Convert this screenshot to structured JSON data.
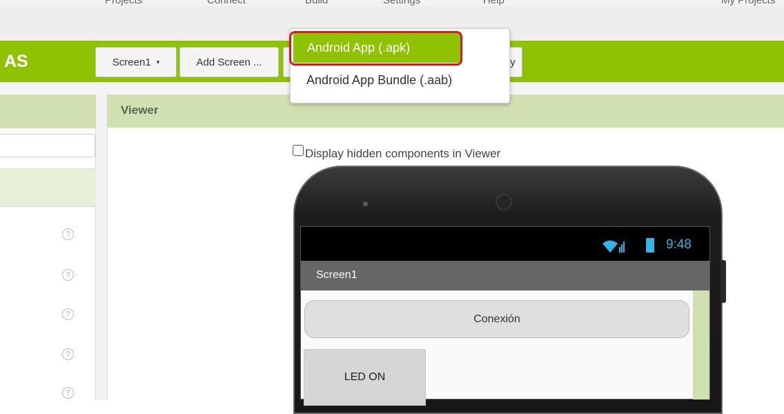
{
  "top_menu": {
    "items": [
      "Projects",
      "Connect",
      "Build",
      "Settings",
      "Help",
      "My Projects"
    ]
  },
  "app": {
    "name_fragment": "AS"
  },
  "toolbar": {
    "screen_dropdown_label": "Screen1",
    "screen_dropdown_caret": "▾",
    "add_screen_label": "Add Screen ...",
    "partial_button_tail": "y"
  },
  "build_menu": {
    "items": [
      {
        "label": "Android App (.apk)",
        "highlighted": true
      },
      {
        "label": "Android App Bundle (.aab)",
        "highlighted": false
      }
    ]
  },
  "left_panel": {
    "help_icon_glyph": "?",
    "help_icon_count": 5
  },
  "viewer": {
    "title": "Viewer",
    "hidden_components_label": "Display hidden components in Viewer",
    "hidden_components_checked": false
  },
  "phone": {
    "clock": "9:48",
    "screen_title": "Screen1",
    "buttons": [
      {
        "label": "Conexión"
      },
      {
        "label": "LED ON"
      }
    ]
  },
  "colors": {
    "toolbar_green": "#8fc202",
    "panel_header": "#d1e0b0",
    "status_blue": "#33b5e5",
    "highlight_red": "#e0161e"
  }
}
